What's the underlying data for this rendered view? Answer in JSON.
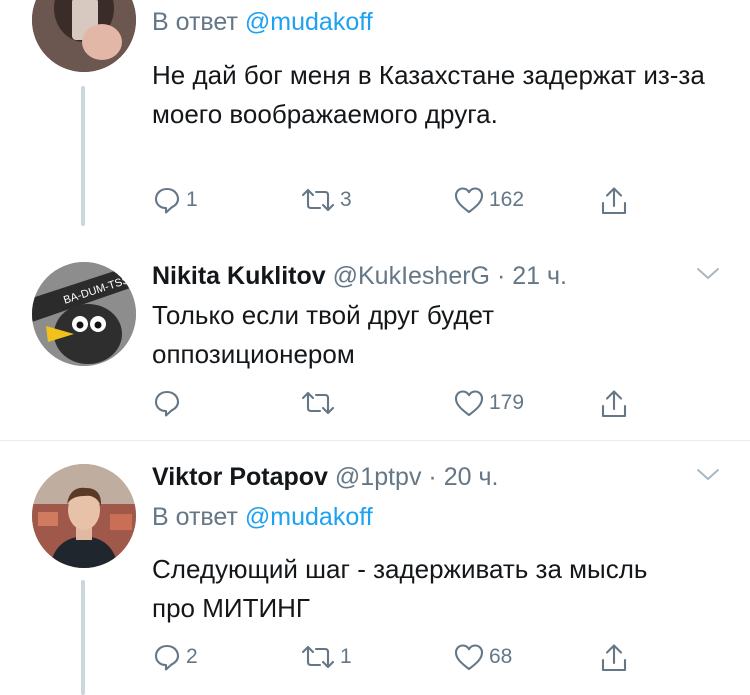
{
  "tweets": [
    {
      "reply_prefix": "В ответ",
      "reply_handle": "@mudakoff",
      "text": "Не дай бог меня в Казахстане задержат из-за моего воображаемого друга.",
      "replies": "1",
      "retweets": "3",
      "likes": "162"
    },
    {
      "name": "Nikita Kuklitov",
      "handle": "@KukIesherG",
      "time": "· 21 ч.",
      "avatar_text": "BA-DUM-TSS",
      "text": "Только если твой друг будет оппозиционером",
      "replies": "",
      "retweets": "",
      "likes": "179"
    },
    {
      "name": "Viktor Potapov",
      "handle": "@1ptpv",
      "time": "· 20 ч.",
      "reply_prefix": "В ответ",
      "reply_handle": "@mudakoff",
      "text": "Следующий шаг - задерживать за мысль про МИТИНГ",
      "replies": "2",
      "retweets": "1",
      "likes": "68"
    }
  ],
  "colors": {
    "accent": "#1da1f2",
    "muted": "#657786",
    "text": "#14171a",
    "thread_line": "#ccd6dd"
  },
  "icons": [
    "reply-icon",
    "retweet-icon",
    "like-icon",
    "share-icon",
    "chevron-down-icon"
  ]
}
